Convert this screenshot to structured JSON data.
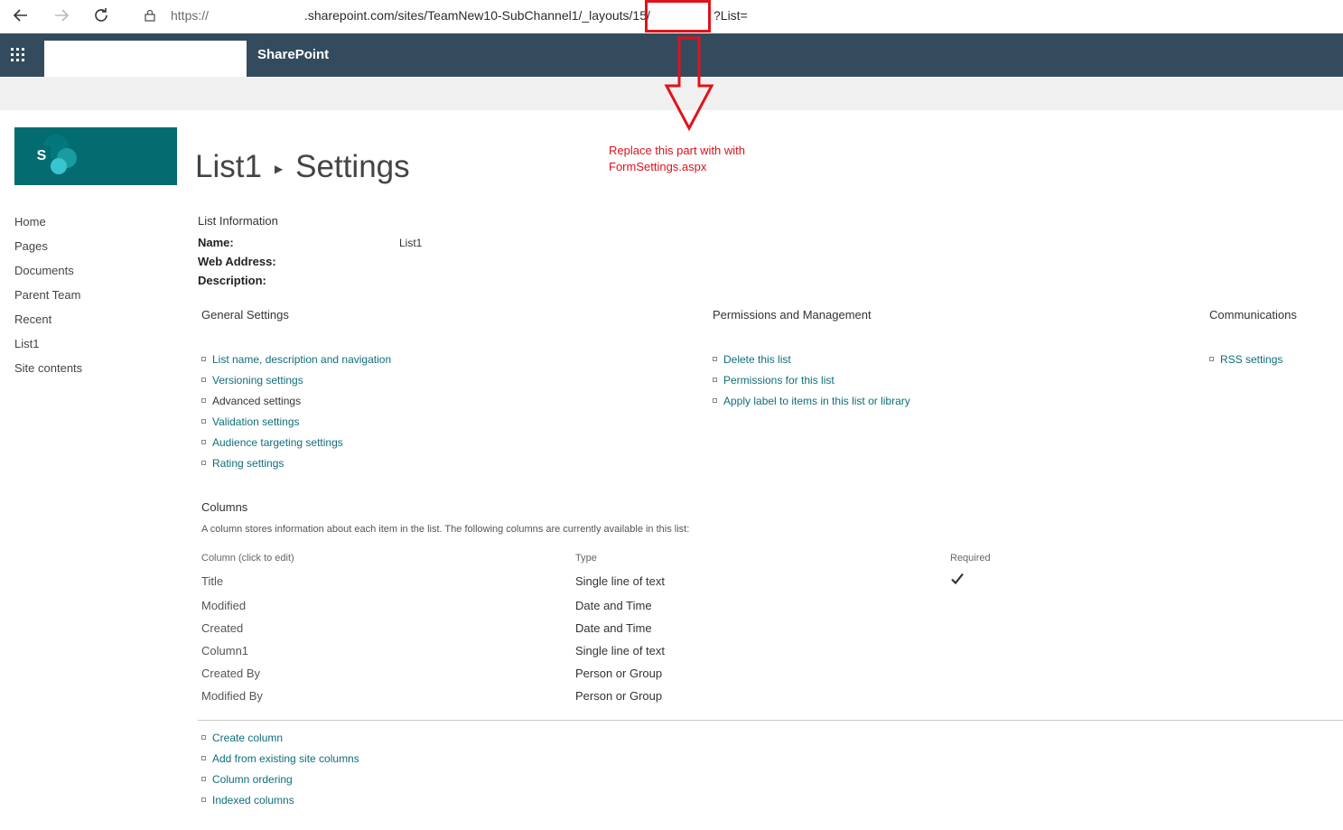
{
  "browser": {
    "url_prefix": "https://",
    "url_main": ".sharepoint.com/sites/TeamNew10-SubChannel1/_layouts/15/",
    "url_suffix": "?List="
  },
  "suite": {
    "title": "SharePoint"
  },
  "site_logo_letter": "S",
  "left_nav": [
    "Home",
    "Pages",
    "Documents",
    "Parent Team",
    "Recent",
    "List1",
    "Site contents"
  ],
  "page": {
    "list_name": "List1",
    "settings": "Settings"
  },
  "annotation": {
    "line1": "Replace this part with with",
    "line2": "FormSettings.aspx"
  },
  "list_info": {
    "heading": "List Information",
    "name_label": "Name:",
    "name_value": "List1",
    "web_address_label": "Web Address:",
    "description_label": "Description:"
  },
  "general_settings": {
    "heading": "General Settings",
    "links": [
      {
        "label": "List name, description and navigation",
        "link": true
      },
      {
        "label": "Versioning settings",
        "link": true
      },
      {
        "label": "Advanced settings",
        "link": false
      },
      {
        "label": "Validation settings",
        "link": true
      },
      {
        "label": "Audience targeting settings",
        "link": true
      },
      {
        "label": "Rating settings",
        "link": true
      }
    ]
  },
  "permissions": {
    "heading": "Permissions and Management",
    "links": [
      {
        "label": "Delete this list"
      },
      {
        "label": "Permissions for this list"
      },
      {
        "label": "Apply label to items in this list or library"
      }
    ]
  },
  "communications": {
    "heading": "Communications",
    "links": [
      {
        "label": "RSS settings"
      }
    ]
  },
  "columns": {
    "heading": "Columns",
    "description": "A column stores information about each item in the list. The following columns are currently available in this list:",
    "header_name": "Column (click to edit)",
    "header_type": "Type",
    "header_required": "Required",
    "rows": [
      {
        "name": "Title",
        "type": "Single line of text",
        "required": true
      },
      {
        "name": "Modified",
        "type": "Date and Time",
        "required": false
      },
      {
        "name": "Created",
        "type": "Date and Time",
        "required": false
      },
      {
        "name": "Column1",
        "type": "Single line of text",
        "required": false
      },
      {
        "name": "Created By",
        "type": "Person or Group",
        "required": false
      },
      {
        "name": "Modified By",
        "type": "Person or Group",
        "required": false
      }
    ],
    "actions": [
      "Create column",
      "Add from existing site columns",
      "Column ordering",
      "Indexed columns"
    ]
  }
}
